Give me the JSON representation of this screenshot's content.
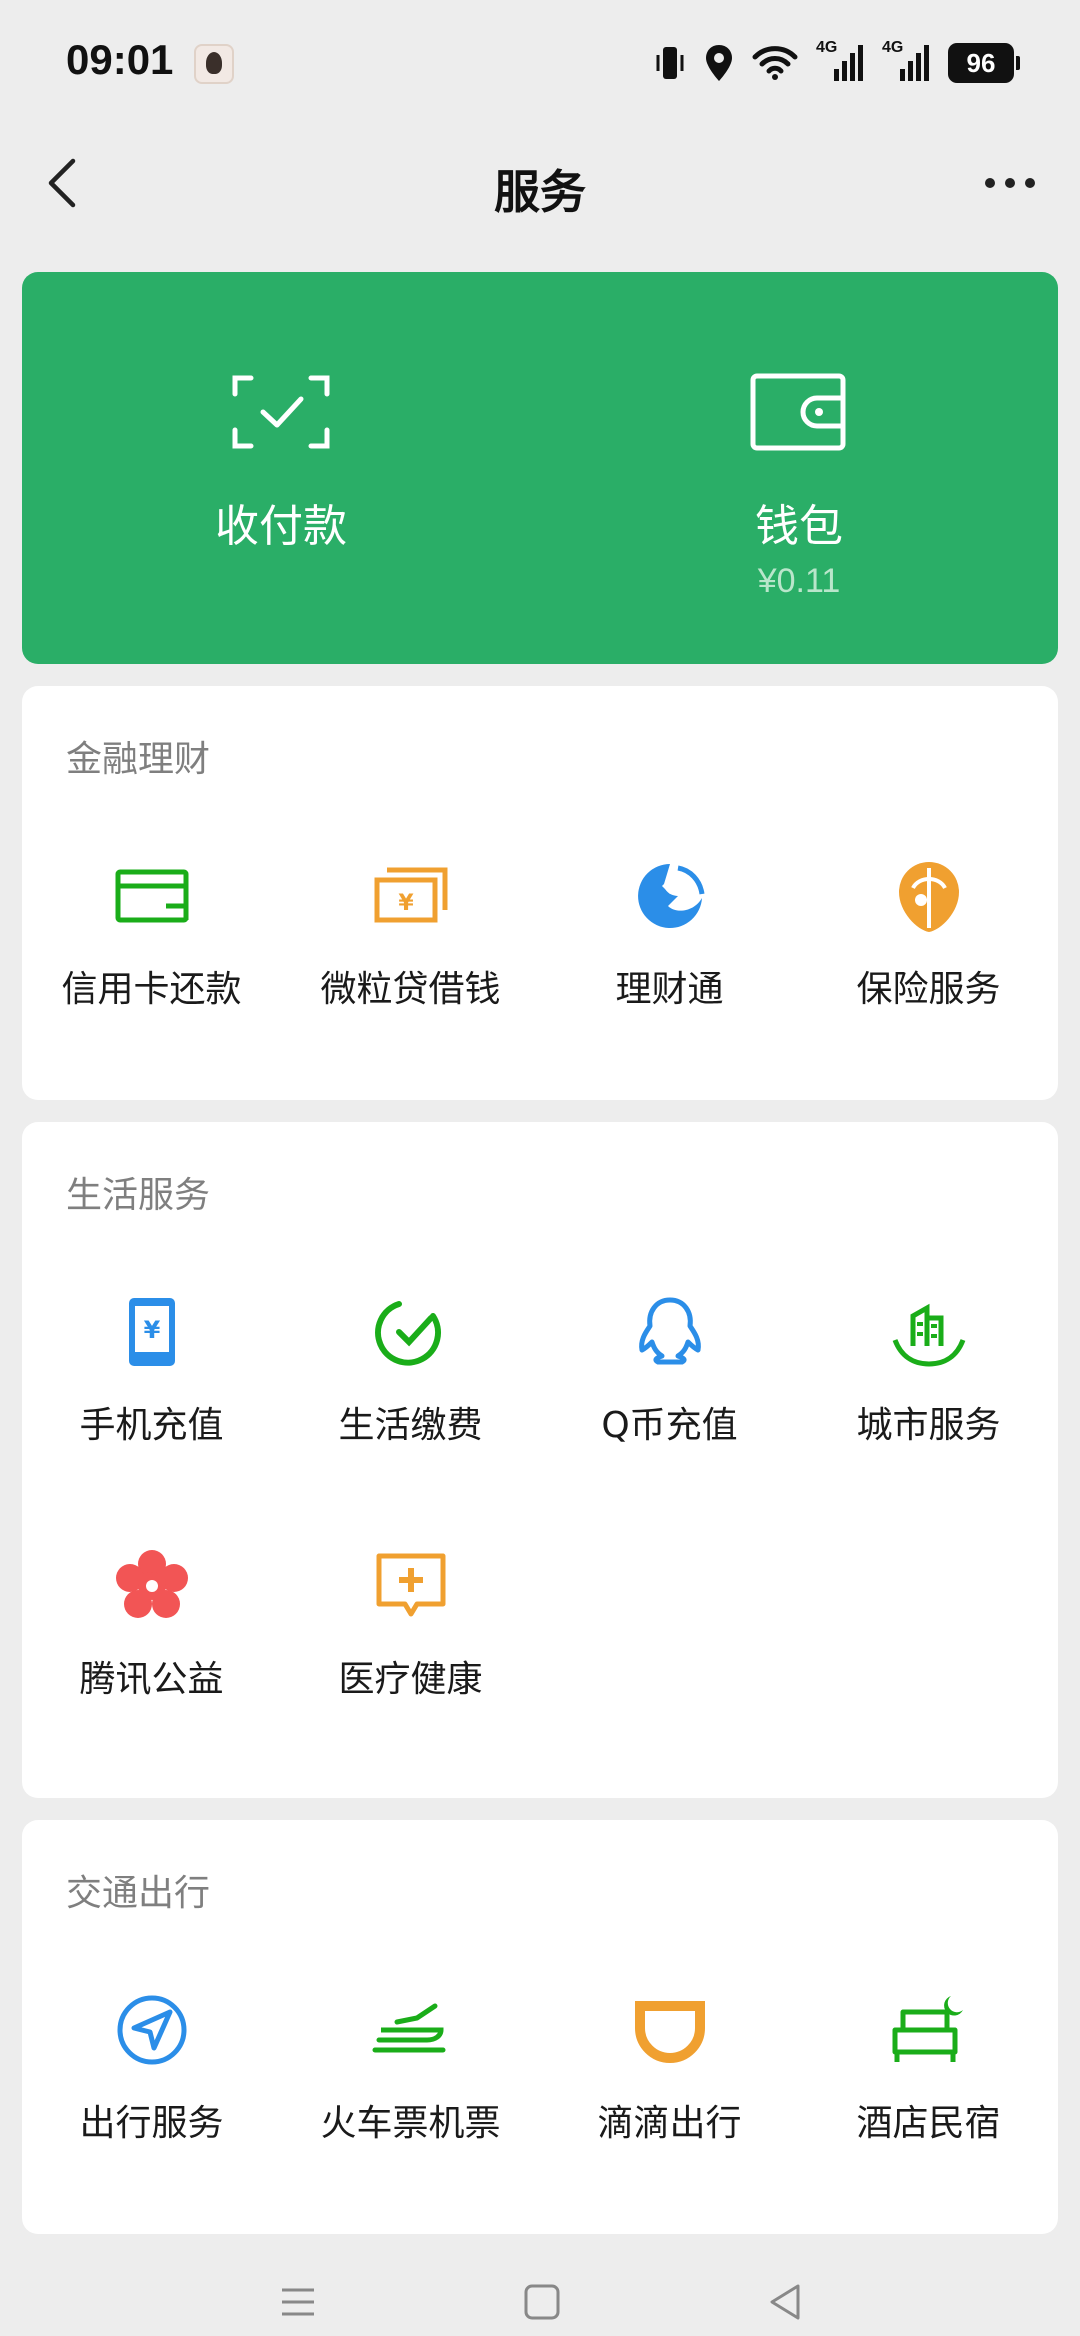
{
  "status_bar": {
    "time": "09:01",
    "network_1": "4G",
    "network_2": "4G",
    "battery": "96"
  },
  "nav": {
    "title": "服务"
  },
  "hero": {
    "pay": {
      "label": "收付款",
      "icon": "scan-pay-icon"
    },
    "wallet": {
      "label": "钱包",
      "balance": "¥0.11",
      "icon": "wallet-icon"
    },
    "color": "#2aae67"
  },
  "sections": [
    {
      "title": "金融理财",
      "items": [
        {
          "label": "信用卡还款",
          "icon": "credit-card-icon",
          "color": "#1aad19"
        },
        {
          "label": "微粒贷借钱",
          "icon": "loan-icon",
          "color": "#f0a030"
        },
        {
          "label": "理财通",
          "icon": "wealth-icon",
          "color": "#2b8ee8"
        },
        {
          "label": "保险服务",
          "icon": "insurance-icon",
          "color": "#f0a030"
        }
      ]
    },
    {
      "title": "生活服务",
      "items": [
        {
          "label": "手机充值",
          "icon": "phone-topup-icon",
          "color": "#2b8ee8"
        },
        {
          "label": "生活缴费",
          "icon": "utility-icon",
          "color": "#1aad19"
        },
        {
          "label": "Q币充值",
          "icon": "qq-coin-icon",
          "color": "#2b8ee8"
        },
        {
          "label": "城市服务",
          "icon": "city-icon",
          "color": "#1aad19"
        },
        {
          "label": "腾讯公益",
          "icon": "charity-icon",
          "color": "#f25555"
        },
        {
          "label": "医疗健康",
          "icon": "medical-icon",
          "color": "#f0a030"
        }
      ]
    },
    {
      "title": "交通出行",
      "items": [
        {
          "label": "出行服务",
          "icon": "travel-icon",
          "color": "#2b8ee8"
        },
        {
          "label": "火车票机票",
          "icon": "train-plane-icon",
          "color": "#1aad19"
        },
        {
          "label": "滴滴出行",
          "icon": "didi-icon",
          "color": "#f0a030"
        },
        {
          "label": "酒店民宿",
          "icon": "hotel-icon",
          "color": "#1aad19"
        }
      ]
    }
  ]
}
